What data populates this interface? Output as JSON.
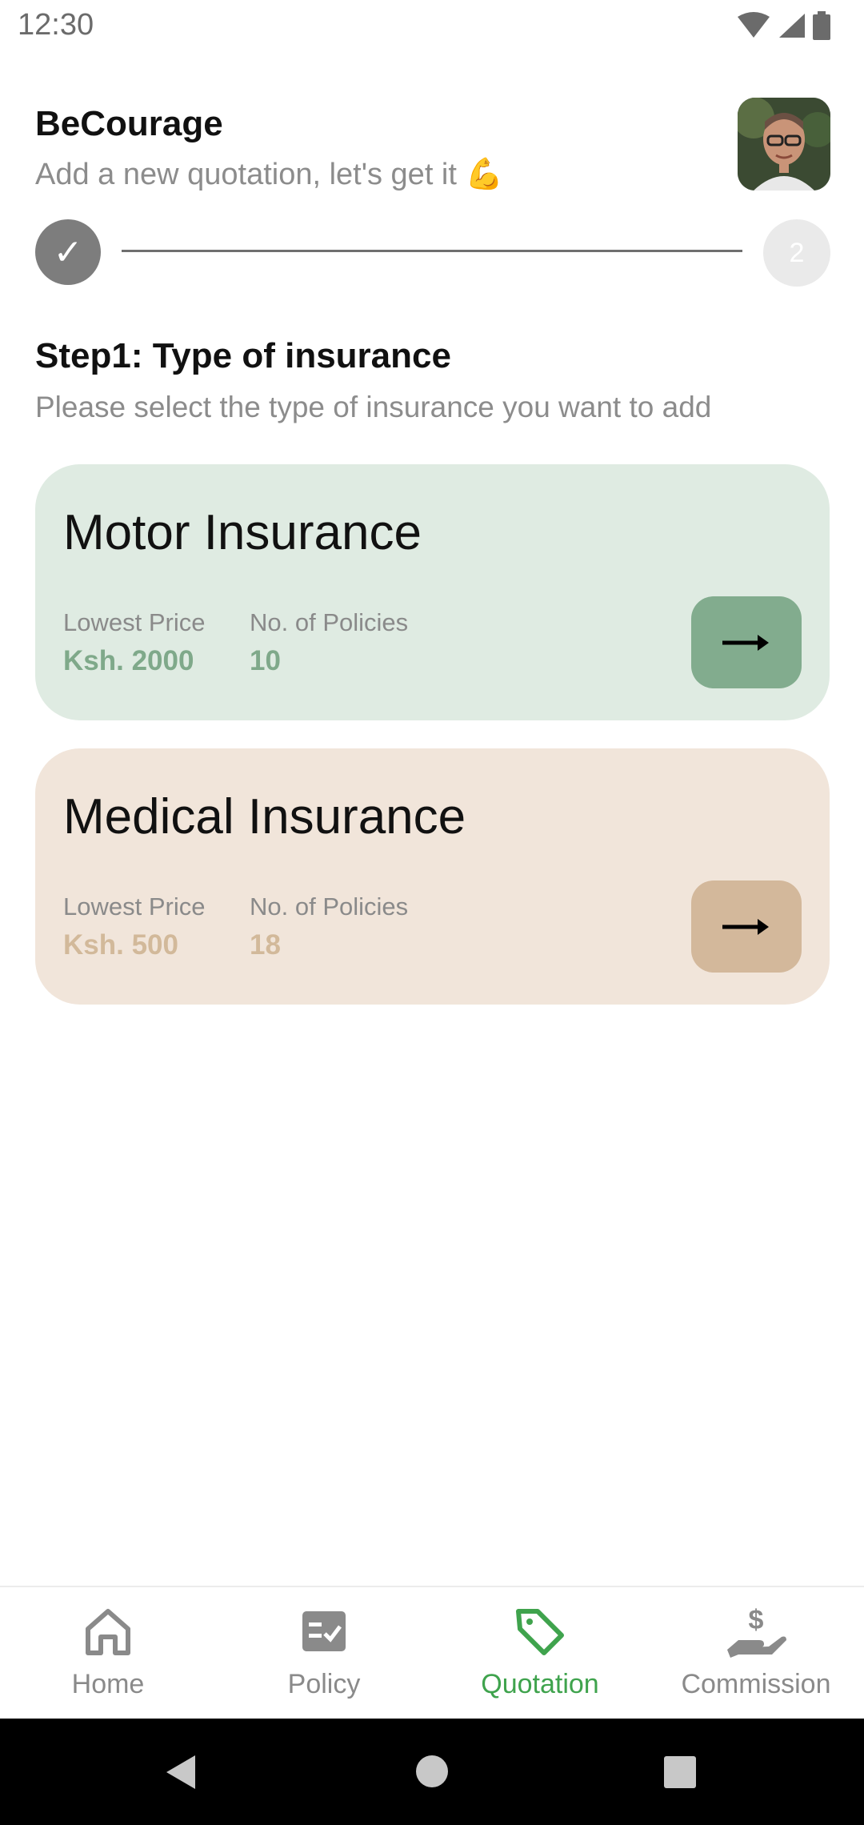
{
  "status_bar": {
    "time": "12:30"
  },
  "header": {
    "title": "BeCourage",
    "subtitle": "Add a new quotation, let's get it 💪"
  },
  "stepper": {
    "done_mark": "✓",
    "next_step": "2"
  },
  "section": {
    "title": "Step1: Type of insurance",
    "subtitle": "Please select the type of insurance you want to add"
  },
  "cards": [
    {
      "title": "Motor Insurance",
      "price_label": "Lowest Price",
      "price_value": "Ksh. 2000",
      "policies_label": "No. of Policies",
      "policies_value": "10",
      "color": "#dfebe2",
      "accent": "#82ac8e"
    },
    {
      "title": "Medical Insurance",
      "price_label": "Lowest Price",
      "price_value": "Ksh. 500",
      "policies_label": "No. of Policies",
      "policies_value": "18",
      "color": "#f1e5da",
      "accent": "#d3b89b"
    }
  ],
  "bottom_nav": {
    "items": [
      {
        "label": "Home",
        "icon": "home-icon"
      },
      {
        "label": "Policy",
        "icon": "policy-icon"
      },
      {
        "label": "Quotation",
        "icon": "tag-icon",
        "active": true
      },
      {
        "label": "Commission",
        "icon": "dollar-hand-icon"
      }
    ],
    "active_color": "#3fa34d",
    "inactive_color": "#8a8a8a"
  }
}
